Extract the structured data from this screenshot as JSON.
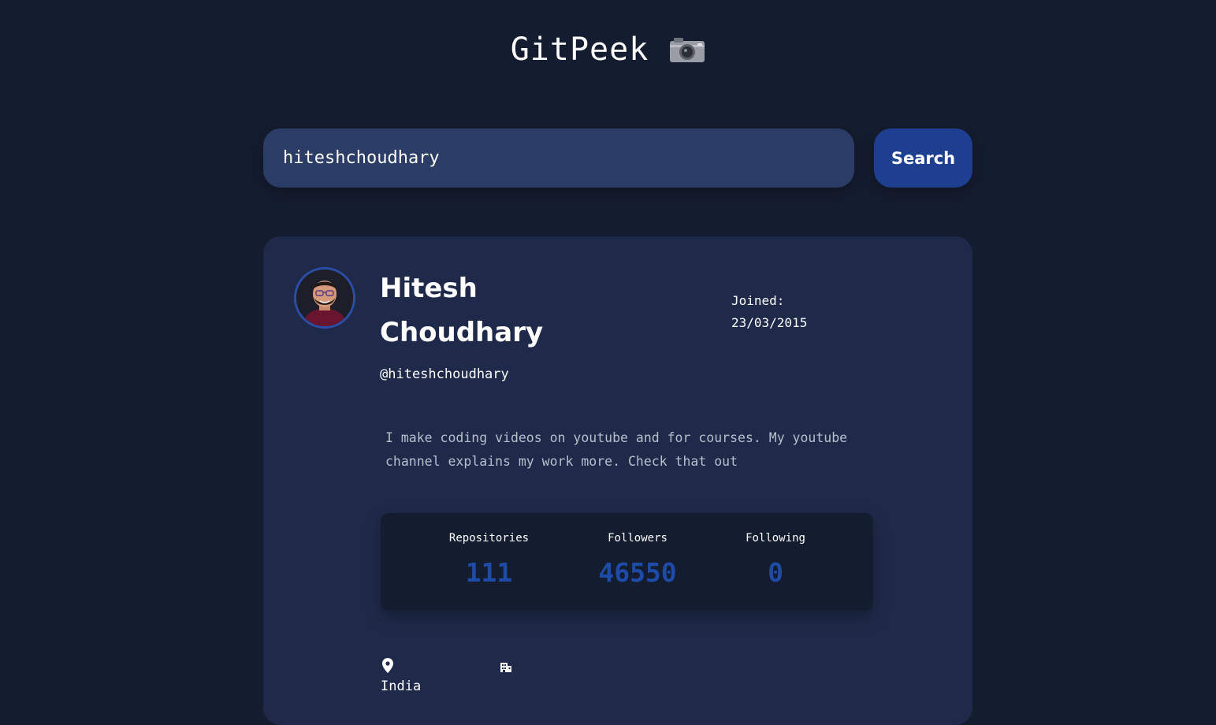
{
  "app": {
    "title": "GitPeek",
    "title_icon": "camera-icon"
  },
  "search": {
    "value": "hiteshchoudhary",
    "button_label": "Search"
  },
  "profile": {
    "name": "Hitesh Choudhary",
    "login": "@hiteshchoudhary",
    "joined_label": "Joined:",
    "joined_date": "23/03/2015",
    "bio": "I make coding videos on youtube and for courses. My youtube channel explains my work more. Check that out",
    "stats": {
      "repos_label": "Repositories",
      "repos_value": "111",
      "followers_label": "Followers",
      "followers_value": "46550",
      "following_label": "Following",
      "following_value": "0"
    },
    "location_icon": "map-pin-icon",
    "location": "India",
    "company_icon": "building-icon"
  },
  "colors": {
    "background": "#141c2f",
    "card": "#1f2a4a",
    "input": "#2b3c66",
    "accent": "#1e3f8f",
    "stat_value": "#1e4aa8"
  }
}
